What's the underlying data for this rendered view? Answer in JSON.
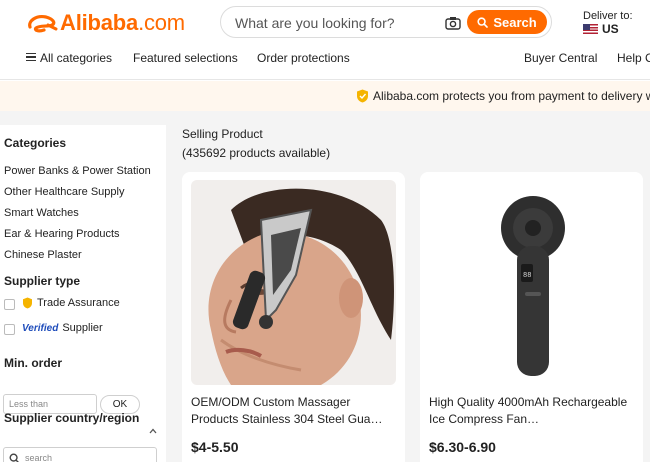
{
  "header": {
    "logo_text": "Alibaba",
    "logo_suffix": ".com",
    "search_placeholder": "What are you looking for?",
    "search_button": "Search",
    "deliver_label": "Deliver to:",
    "deliver_country": "US"
  },
  "nav": {
    "all_categories": "All categories",
    "featured": "Featured selections",
    "order_protections": "Order protections",
    "buyer_central": "Buyer Central",
    "help": "Help C"
  },
  "banner": {
    "text": "Alibaba.com protects you from payment to delivery with T"
  },
  "sidebar": {
    "categories_title": "Categories",
    "categories": [
      "Power Banks & Power Station",
      "Other Healthcare Supply",
      "Smart Watches",
      "Ear & Hearing Products",
      "Chinese Plaster"
    ],
    "supplier_type_title": "Supplier type",
    "trade_assurance": "Trade Assurance",
    "verified_badge": "Verified",
    "verified_supplier": "Supplier",
    "min_order_title": "Min. order",
    "min_order_placeholder": "Less than",
    "ok_button": "OK",
    "region_title": "Supplier country/region",
    "region_search_placeholder": "search"
  },
  "results": {
    "title": "Selling Product",
    "count": "(435692 products available)",
    "products": [
      {
        "name": "OEM/ODM Custom Massager Products Stainless 304 Steel Gua…",
        "price": "$4-5.50"
      },
      {
        "name": "High Quality 4000mAh Rechargeable Ice Compress Fan…",
        "price": "$6.30-6.90"
      }
    ]
  },
  "colors": {
    "brand": "#ff6a00",
    "banner_bg": "#fff7ee",
    "page_bg": "#f4f4f4"
  }
}
